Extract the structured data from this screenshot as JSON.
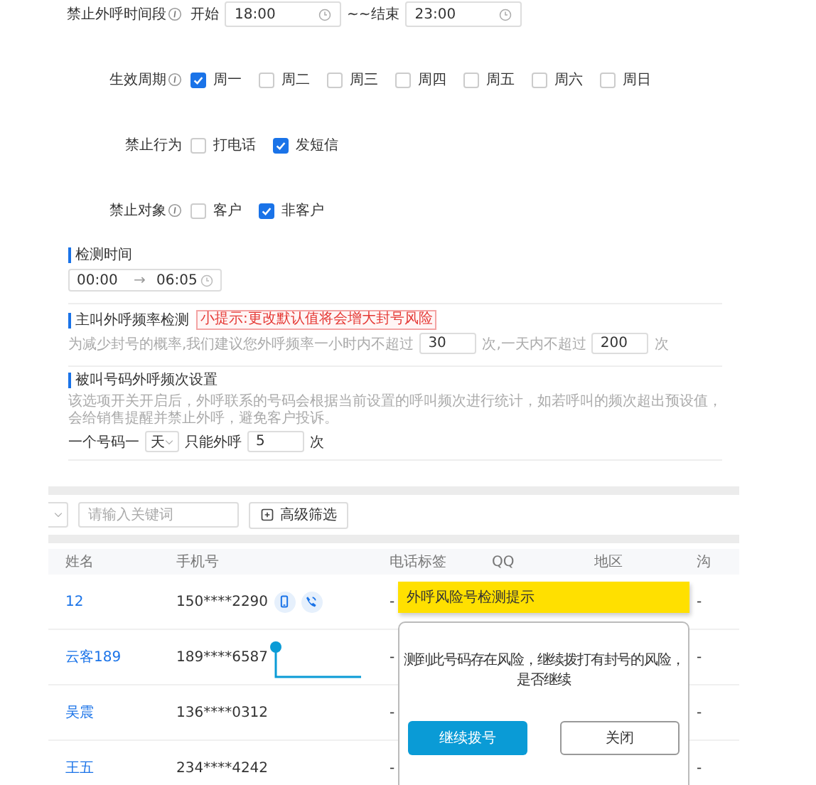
{
  "form": {
    "period": {
      "label": "禁止外呼时间段",
      "info": true,
      "start_label": "开始",
      "start": "18:00",
      "end_label": "~~结束",
      "end": "23:00"
    },
    "cycle": {
      "label": "生效周期",
      "info": true,
      "options": [
        {
          "label": "周一",
          "checked": true
        },
        {
          "label": "周二",
          "checked": false
        },
        {
          "label": "周三",
          "checked": false
        },
        {
          "label": "周四",
          "checked": false
        },
        {
          "label": "周五",
          "checked": false
        },
        {
          "label": "周六",
          "checked": false
        },
        {
          "label": "周日",
          "checked": false
        }
      ]
    },
    "behavior": {
      "label": "禁止行为",
      "info": false,
      "options": [
        {
          "label": "打电话",
          "checked": false
        },
        {
          "label": "发短信",
          "checked": true
        }
      ]
    },
    "target": {
      "label": "禁止对象",
      "info": true,
      "options": [
        {
          "label": "客户",
          "checked": false
        },
        {
          "label": "非客户",
          "checked": true
        }
      ]
    }
  },
  "detect_time": {
    "title": "检测时间",
    "start": "00:00",
    "separator": "→",
    "end": "06:05"
  },
  "frequency": {
    "title": "主叫外呼频率检测",
    "tip": "小提示:更改默认值将会增大封号风险",
    "text_1": "为减少封号的概率,我们建议您外呼频率一小时内不超过",
    "hour_limit": "30",
    "text_2": "次,一天内不超过",
    "day_limit": "200",
    "text_3": "次"
  },
  "callee": {
    "title": "被叫号码外呼频次设置",
    "description": "该选项开关开启后，外呼联系的号码会根据当前设置的呼叫频次进行统计，如若呼叫的频次超出预设值，会给销售提醒并禁止外呼，避免客户投诉。",
    "prefix": "一个号码一",
    "unit": "天",
    "middle": "只能外呼",
    "limit": "5",
    "suffix": "次"
  },
  "toolbar": {
    "search_placeholder": "请输入关键词",
    "filter_button": "高级筛选"
  },
  "table": {
    "columns": [
      "姓名",
      "手机号",
      "电话标签",
      "QQ",
      "地区",
      "沟"
    ],
    "rows": [
      {
        "name": "12",
        "phone": "150****2290",
        "actions": true,
        "tag": "-",
        "column_6": "-"
      },
      {
        "name": "云客189",
        "phone": "189****6587",
        "actions": false,
        "tag": "-",
        "column_6": "-"
      },
      {
        "name": "吴震",
        "phone": "136****0312",
        "actions": false,
        "tag": "-",
        "column_6": "-"
      },
      {
        "name": "王五",
        "phone": "234****4242",
        "actions": false,
        "tag": "-",
        "column_6": "-"
      }
    ]
  },
  "dialog": {
    "banner": "外呼风险号检测提示",
    "message_lines": [
      "测到此号码存在风险，继续拨打有封号的风险，",
      "是否继续"
    ],
    "buttons": [
      {
        "label": "继续拨号",
        "kind": "primary"
      },
      {
        "label": "关闭",
        "kind": "plain"
      }
    ]
  }
}
